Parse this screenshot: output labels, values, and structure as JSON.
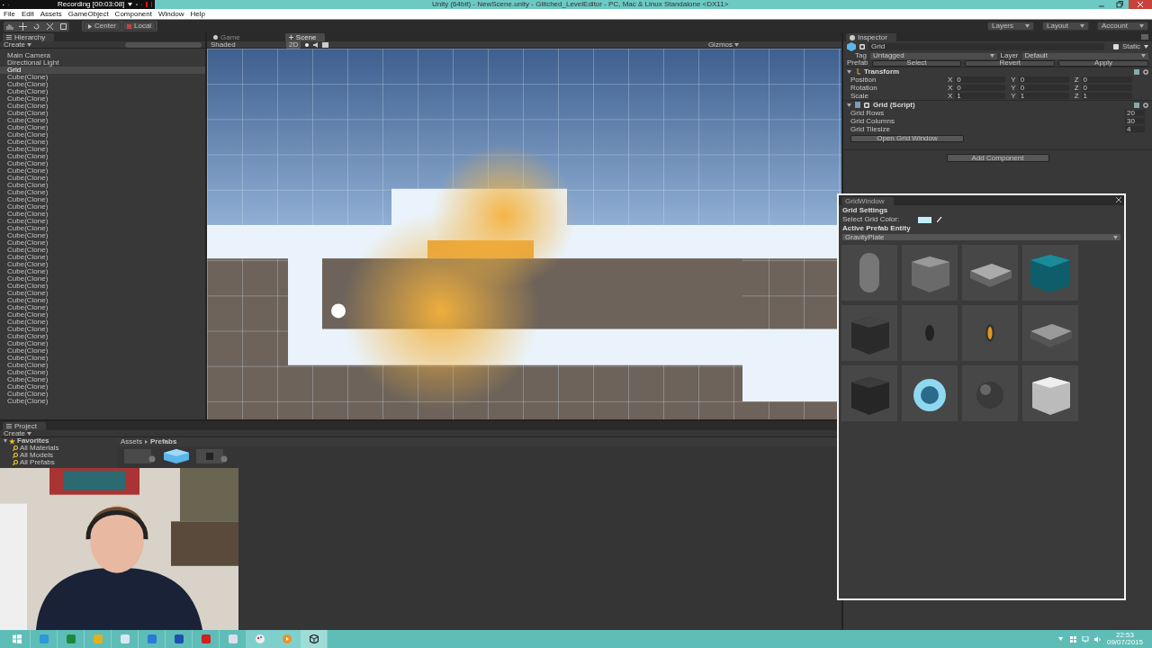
{
  "recorder": {
    "status": "Recording [00:03:08]"
  },
  "window": {
    "title": "Unity (64bit) - NewScene.unity - Glitched_LevelEditor - PC, Mac & Linux Standalone <DX11>"
  },
  "menu": [
    "File",
    "Edit",
    "Assets",
    "GameObject",
    "Component",
    "Window",
    "Help"
  ],
  "toolbar": {
    "pivot": "Center",
    "space": "Local",
    "menus": [
      "Layers",
      "Layout",
      "Account"
    ]
  },
  "hierarchy": {
    "title": "Hierarchy",
    "create": "Create",
    "items": [
      {
        "label": "Main Camera",
        "selected": false
      },
      {
        "label": "Directional Light",
        "selected": false
      },
      {
        "label": "Grid",
        "selected": true
      },
      {
        "label": "Cube(Clone)",
        "selected": false
      },
      {
        "label": "Cube(Clone)",
        "selected": false
      },
      {
        "label": "Cube(Clone)",
        "selected": false
      },
      {
        "label": "Cube(Clone)",
        "selected": false
      },
      {
        "label": "Cube(Clone)",
        "selected": false
      },
      {
        "label": "Cube(Clone)",
        "selected": false
      },
      {
        "label": "Cube(Clone)",
        "selected": false
      },
      {
        "label": "Cube(Clone)",
        "selected": false
      },
      {
        "label": "Cube(Clone)",
        "selected": false
      },
      {
        "label": "Cube(Clone)",
        "selected": false
      },
      {
        "label": "Cube(Clone)",
        "selected": false
      },
      {
        "label": "Cube(Clone)",
        "selected": false
      },
      {
        "label": "Cube(Clone)",
        "selected": false
      },
      {
        "label": "Cube(Clone)",
        "selected": false
      },
      {
        "label": "Cube(Clone)",
        "selected": false
      },
      {
        "label": "Cube(Clone)",
        "selected": false
      },
      {
        "label": "Cube(Clone)",
        "selected": false
      },
      {
        "label": "Cube(Clone)",
        "selected": false
      },
      {
        "label": "Cube(Clone)",
        "selected": false
      },
      {
        "label": "Cube(Clone)",
        "selected": false
      },
      {
        "label": "Cube(Clone)",
        "selected": false
      },
      {
        "label": "Cube(Clone)",
        "selected": false
      },
      {
        "label": "Cube(Clone)",
        "selected": false
      },
      {
        "label": "Cube(Clone)",
        "selected": false
      },
      {
        "label": "Cube(Clone)",
        "selected": false
      },
      {
        "label": "Cube(Clone)",
        "selected": false
      },
      {
        "label": "Cube(Clone)",
        "selected": false
      },
      {
        "label": "Cube(Clone)",
        "selected": false
      },
      {
        "label": "Cube(Clone)",
        "selected": false
      },
      {
        "label": "Cube(Clone)",
        "selected": false
      },
      {
        "label": "Cube(Clone)",
        "selected": false
      },
      {
        "label": "Cube(Clone)",
        "selected": false
      },
      {
        "label": "Cube(Clone)",
        "selected": false
      },
      {
        "label": "Cube(Clone)",
        "selected": false
      },
      {
        "label": "Cube(Clone)",
        "selected": false
      },
      {
        "label": "Cube(Clone)",
        "selected": false
      },
      {
        "label": "Cube(Clone)",
        "selected": false
      },
      {
        "label": "Cube(Clone)",
        "selected": false
      },
      {
        "label": "Cube(Clone)",
        "selected": false
      },
      {
        "label": "Cube(Clone)",
        "selected": false
      },
      {
        "label": "Cube(Clone)",
        "selected": false
      },
      {
        "label": "Cube(Clone)",
        "selected": false
      },
      {
        "label": "Cube(Clone)",
        "selected": false
      },
      {
        "label": "Cube(Clone)",
        "selected": false
      },
      {
        "label": "Cube(Clone)",
        "selected": false
      },
      {
        "label": "Cube(Clone)",
        "selected": false
      }
    ]
  },
  "scene_view": {
    "tabs": [
      {
        "label": "Game",
        "selected": false
      },
      {
        "label": "Scene",
        "selected": true
      }
    ],
    "shading": "Shaded",
    "mode_2d": "2D",
    "gizmos": "Gizmos"
  },
  "inspector": {
    "title": "Inspector",
    "active": true,
    "name": "Grid",
    "static_label": "Static",
    "static": false,
    "tag_label": "Tag",
    "tag": "Untagged",
    "layer_label": "Layer",
    "layer": "Default",
    "prefab_label": "Prefab",
    "prefab_buttons": [
      "Select",
      "Revert",
      "Apply"
    ],
    "components": [
      {
        "kind": "transform",
        "title": "Transform",
        "rows": [
          {
            "label": "Position",
            "values": [
              {
                "axis": "X",
                "value": "0"
              },
              {
                "axis": "Y",
                "value": "0"
              },
              {
                "axis": "Z",
                "value": "0"
              }
            ]
          },
          {
            "label": "Rotation",
            "values": [
              {
                "axis": "X",
                "value": "0"
              },
              {
                "axis": "Y",
                "value": "0"
              },
              {
                "axis": "Z",
                "value": "0"
              }
            ]
          },
          {
            "label": "Scale",
            "values": [
              {
                "axis": "X",
                "value": "1"
              },
              {
                "axis": "Y",
                "value": "1"
              },
              {
                "axis": "Z",
                "value": "1"
              }
            ]
          }
        ]
      },
      {
        "kind": "script",
        "title": "Grid (Script)",
        "enabled": true,
        "fields": [
          {
            "label": "Grid Rows",
            "value": "20"
          },
          {
            "label": "Grid Columns",
            "value": "30"
          },
          {
            "label": "Grid Tilesize",
            "value": "4"
          }
        ],
        "button": "Open Grid Window"
      }
    ],
    "add_component": "Add Component"
  },
  "grid_window": {
    "title": "GridWindow",
    "settings_heading": "Grid Settings",
    "color_label": "Select Grid Color:",
    "prefab_heading": "Active Prefab Entity",
    "prefab": "GravityPlate"
  },
  "project": {
    "title": "Project",
    "create": "Create",
    "favorites": {
      "label": "Favorites",
      "expanded": true,
      "children": [
        {
          "label": "All Materials"
        },
        {
          "label": "All Models"
        },
        {
          "label": "All Prefabs"
        }
      ]
    },
    "breadcrumb": [
      "Assets",
      "Prefabs"
    ]
  },
  "taskbar": {
    "time": "22:53",
    "date": "09/07/2015"
  }
}
